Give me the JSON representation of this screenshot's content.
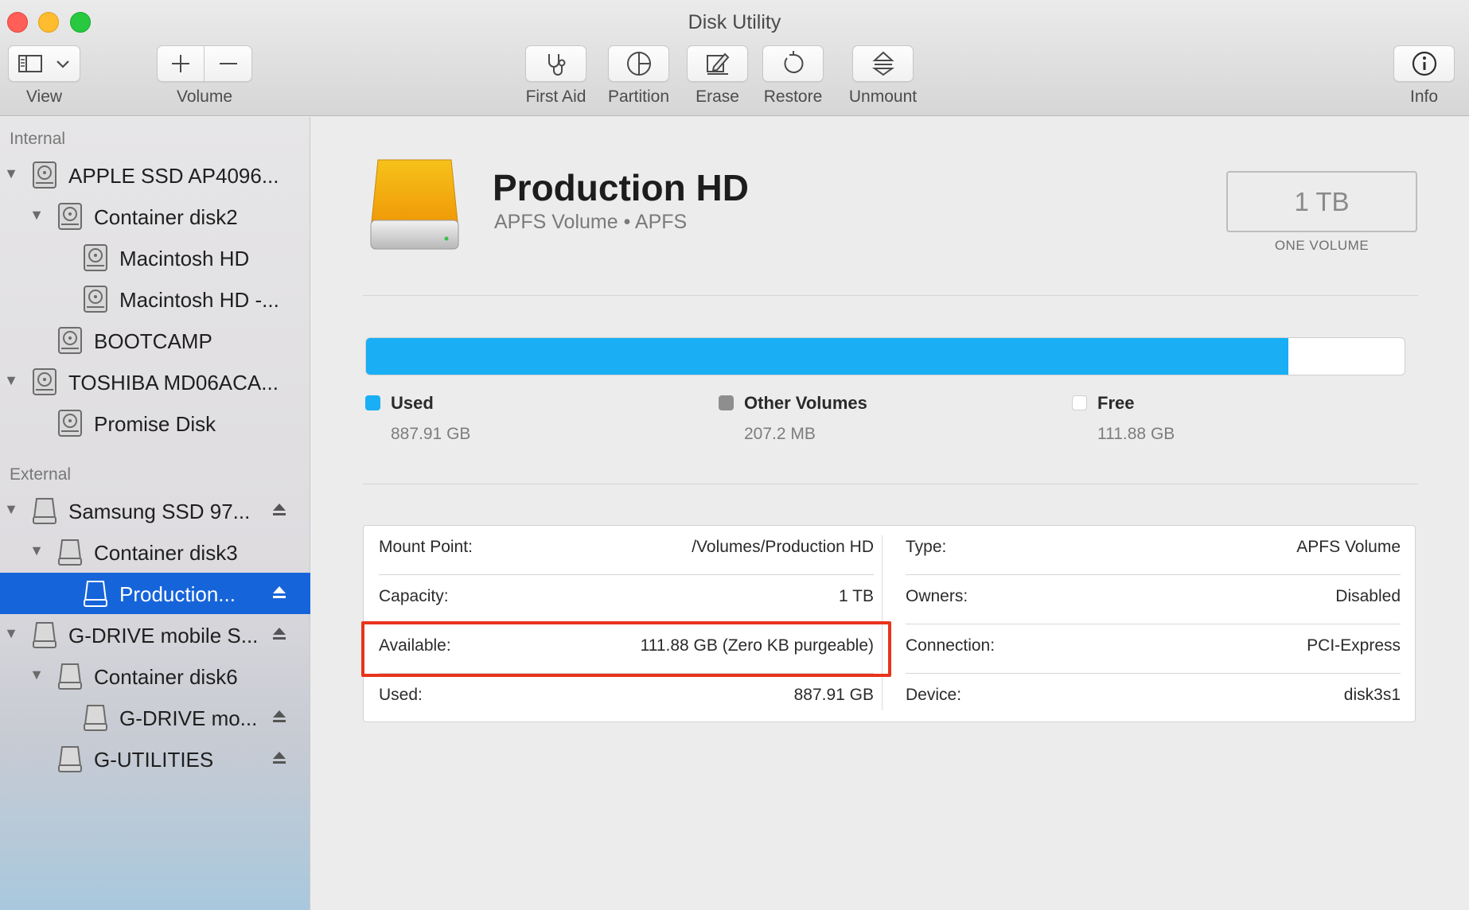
{
  "window": {
    "title": "Disk Utility"
  },
  "toolbar": {
    "view": {
      "label": "View",
      "icon": "sidebar-icon"
    },
    "volume": {
      "label": "Volume",
      "add_icon": "plus-icon",
      "remove_icon": "minus-icon"
    },
    "first_aid": {
      "label": "First Aid",
      "icon": "stethoscope-icon"
    },
    "partition": {
      "label": "Partition",
      "icon": "pie-chart-icon"
    },
    "erase": {
      "label": "Erase",
      "icon": "erase-icon"
    },
    "restore": {
      "label": "Restore",
      "icon": "restore-icon"
    },
    "unmount": {
      "label": "Unmount",
      "icon": "unmount-icon"
    },
    "info": {
      "label": "Info",
      "icon": "info-icon"
    }
  },
  "sidebar": {
    "internal_header": "Internal",
    "external_header": "External",
    "internal_items": [
      {
        "label": "APPLE SSD AP4096...",
        "level": 0,
        "disclosure": true
      },
      {
        "label": "Container disk2",
        "level": 1,
        "disclosure": true
      },
      {
        "label": "Macintosh HD",
        "level": 2,
        "disclosure": false
      },
      {
        "label": "Macintosh HD -...",
        "level": 2,
        "disclosure": false
      },
      {
        "label": "BOOTCAMP",
        "level": 1,
        "disclosure": false
      },
      {
        "label": "TOSHIBA MD06ACA...",
        "level": 0,
        "disclosure": true
      },
      {
        "label": "Promise Disk",
        "level": 1,
        "disclosure": false
      }
    ],
    "external_items": [
      {
        "label": "Samsung SSD 97...",
        "level": 0,
        "disclosure": true,
        "eject": true
      },
      {
        "label": "Container disk3",
        "level": 1,
        "disclosure": true,
        "eject": false
      },
      {
        "label": "Production...",
        "level": 2,
        "disclosure": false,
        "eject": true,
        "selected": true
      },
      {
        "label": "G-DRIVE mobile S...",
        "level": 0,
        "disclosure": true,
        "eject": true
      },
      {
        "label": "Container disk6",
        "level": 1,
        "disclosure": true,
        "eject": false
      },
      {
        "label": "G-DRIVE mo...",
        "level": 2,
        "disclosure": false,
        "eject": true
      },
      {
        "label": "G-UTILITIES",
        "level": 1,
        "disclosure": false,
        "eject": true
      }
    ]
  },
  "volume": {
    "name": "Production HD",
    "subtitle": "APFS Volume • APFS",
    "size": "1 TB",
    "size_caption": "ONE VOLUME"
  },
  "usage": {
    "used_fraction": 0.888,
    "legend": [
      {
        "name": "Used",
        "value": "887.91 GB",
        "color": "#1aaef5"
      },
      {
        "name": "Other Volumes",
        "value": "207.2 MB",
        "color": "#8e8e8e"
      },
      {
        "name": "Free",
        "value": "111.88 GB",
        "color": "#ffffff"
      }
    ]
  },
  "info": {
    "left": [
      {
        "key": "Mount Point:",
        "value": "/Volumes/Production HD"
      },
      {
        "key": "Capacity:",
        "value": "1 TB"
      },
      {
        "key": "Available:",
        "value": "111.88 GB (Zero KB purgeable)"
      },
      {
        "key": "Used:",
        "value": "887.91 GB"
      }
    ],
    "right": [
      {
        "key": "Type:",
        "value": "APFS Volume"
      },
      {
        "key": "Owners:",
        "value": "Disabled"
      },
      {
        "key": "Connection:",
        "value": "PCI-Express"
      },
      {
        "key": "Device:",
        "value": "disk3s1"
      }
    ]
  },
  "colors": {
    "accent": "#1664d9",
    "used_bar": "#1aaef5",
    "highlight": "#e8341c"
  }
}
